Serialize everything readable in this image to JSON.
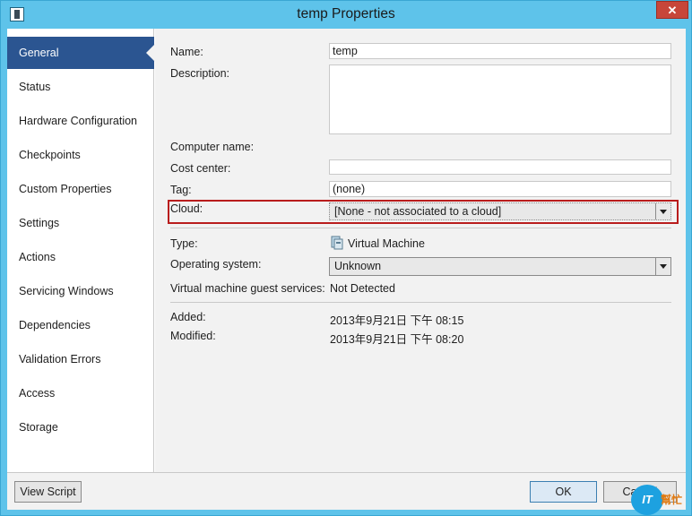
{
  "window": {
    "title": "temp Properties",
    "close_glyph": "✕"
  },
  "sidebar": {
    "items": [
      {
        "label": "General",
        "active": true
      },
      {
        "label": "Status"
      },
      {
        "label": "Hardware Configuration"
      },
      {
        "label": "Checkpoints"
      },
      {
        "label": "Custom Properties"
      },
      {
        "label": "Settings"
      },
      {
        "label": "Actions"
      },
      {
        "label": "Servicing Windows"
      },
      {
        "label": "Dependencies"
      },
      {
        "label": "Validation Errors"
      },
      {
        "label": "Access"
      },
      {
        "label": "Storage"
      }
    ]
  },
  "form": {
    "name_label": "Name:",
    "name_value": "temp",
    "description_label": "Description:",
    "description_value": "",
    "computer_name_label": "Computer name:",
    "cost_center_label": "Cost center:",
    "cost_center_value": "",
    "tag_label": "Tag:",
    "tag_value": "(none)",
    "cloud_label": "Cloud:",
    "cloud_value": "[None - not associated to a cloud]",
    "type_label": "Type:",
    "type_value": "Virtual Machine",
    "type_icon": "virtual-machine-icon",
    "os_label": "Operating system:",
    "os_value": "Unknown",
    "guest_services_label": "Virtual machine guest services:",
    "guest_services_value": "Not Detected",
    "added_label": "Added:",
    "added_value": "2013年9月21日 下午 08:15",
    "modified_label": "Modified:",
    "modified_value": "2013年9月21日 下午 08:20"
  },
  "footer": {
    "view_script_label": "View Script",
    "ok_label": "OK",
    "cancel_label": "Cancel"
  },
  "watermark": {
    "logo_text": "IT",
    "caption": "幫忙"
  },
  "colors": {
    "accent": "#2b5591",
    "highlight": "#b91c1c",
    "frame": "#5ec3ea"
  }
}
